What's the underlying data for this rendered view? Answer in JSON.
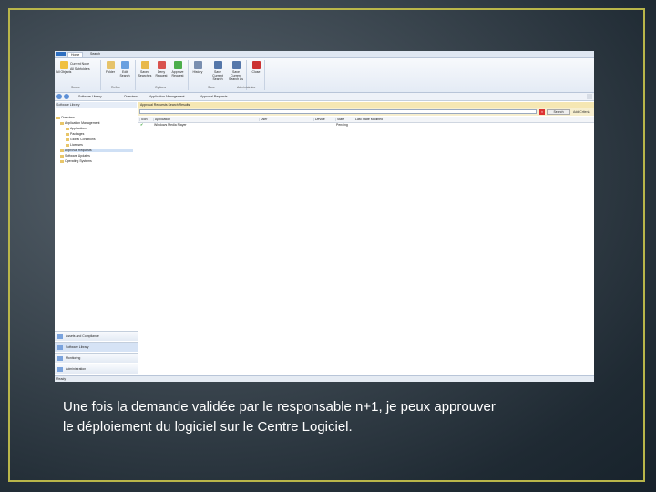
{
  "caption": {
    "line1": "Une fois la demande validée par le responsable n+1, je peux approuver",
    "line2": "le déploiement du logiciel sur le Centre Logiciel."
  },
  "screenshot": {
    "tabs": [
      "Home",
      "Search"
    ],
    "ribbon": {
      "buttons": [
        {
          "label": "All Objects",
          "icon": "all-objects-icon",
          "color": "#f0c040"
        },
        {
          "label": "Folder",
          "icon": "folder-icon",
          "color": "#e6c36a"
        },
        {
          "label": "Edit Search",
          "icon": "edit-search-icon",
          "color": "#6aa0e0"
        },
        {
          "label": "Saved Searches",
          "icon": "saved-searches-icon",
          "color": "#e8b84c"
        },
        {
          "label": "Deny Request",
          "icon": "deny-icon",
          "color": "#d9534f"
        },
        {
          "label": "Approve Request",
          "icon": "approve-icon",
          "color": "#4cae4c"
        },
        {
          "label": "History",
          "icon": "history-icon",
          "color": "#7a8fb0"
        },
        {
          "label": "Save Current Search",
          "icon": "save-icon",
          "color": "#5577aa"
        },
        {
          "label": "Save Current Search As",
          "icon": "save-as-icon",
          "color": "#5577aa"
        },
        {
          "label": "Close",
          "icon": "close-icon",
          "color": "#cc3333"
        }
      ],
      "small_items": [
        "Current Node",
        "All Subfolders"
      ],
      "groups": [
        "Scope",
        "Refine",
        "Options",
        "Save",
        "Administrator"
      ]
    },
    "breadcrumb": [
      "Software Library",
      "Overview",
      "Application Management",
      "Approval Requests"
    ],
    "left_panel": {
      "header": "Software Library",
      "tree": [
        {
          "label": "Overview",
          "level": 0
        },
        {
          "label": "Application Management",
          "level": 1
        },
        {
          "label": "Applications",
          "level": 2
        },
        {
          "label": "Packages",
          "level": 2
        },
        {
          "label": "Global Conditions",
          "level": 2
        },
        {
          "label": "Licenses",
          "level": 2
        },
        {
          "label": "Approval Requests",
          "level": 1,
          "selected": true
        },
        {
          "label": "Software Updates",
          "level": 0
        },
        {
          "label": "Operating Systems",
          "level": 0
        }
      ],
      "workspaces": [
        "Assets and Compliance",
        "Software Library",
        "Monitoring",
        "Administration"
      ]
    },
    "main": {
      "header": "Approval Requests Search Results",
      "search_value": "",
      "search_button": "Search",
      "criteria_label": "Add Criteria",
      "columns": [
        "Icon",
        "Application",
        "User",
        "Device",
        "State",
        "Last State Modified"
      ],
      "rows": [
        {
          "application": "Windows Media Player",
          "user": "",
          "device": "",
          "state": "Pending",
          "modified": ""
        }
      ]
    },
    "status": "Ready"
  }
}
